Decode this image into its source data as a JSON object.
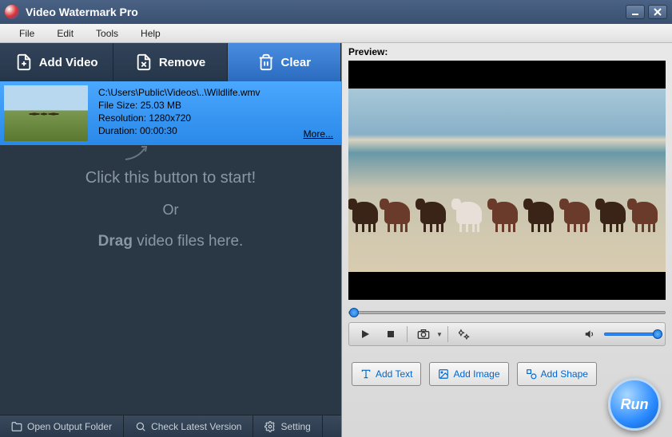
{
  "app": {
    "title": "Video Watermark Pro"
  },
  "menu": {
    "file": "File",
    "edit": "Edit",
    "tools": "Tools",
    "help": "Help"
  },
  "toolbar": {
    "add": "Add Video",
    "remove": "Remove",
    "clear": "Clear"
  },
  "file": {
    "path": "C:\\Users\\Public\\Videos\\..\\Wildlife.wmv",
    "size_label": "File Size: 25.03 MB",
    "resolution_label": "Resolution: 1280x720",
    "duration_label": "Duration: 00:00:30",
    "more": "More..."
  },
  "drop": {
    "line1": "Click this button to start!",
    "or": "Or",
    "drag": "Drag",
    "line2_rest": " video files here."
  },
  "status": {
    "open": "Open Output Folder",
    "check": "Check Latest Version",
    "setting": "Setting"
  },
  "preview": {
    "label": "Preview:"
  },
  "actions": {
    "text": "Add Text",
    "image": "Add Image",
    "shape": "Add Shape",
    "run": "Run"
  }
}
